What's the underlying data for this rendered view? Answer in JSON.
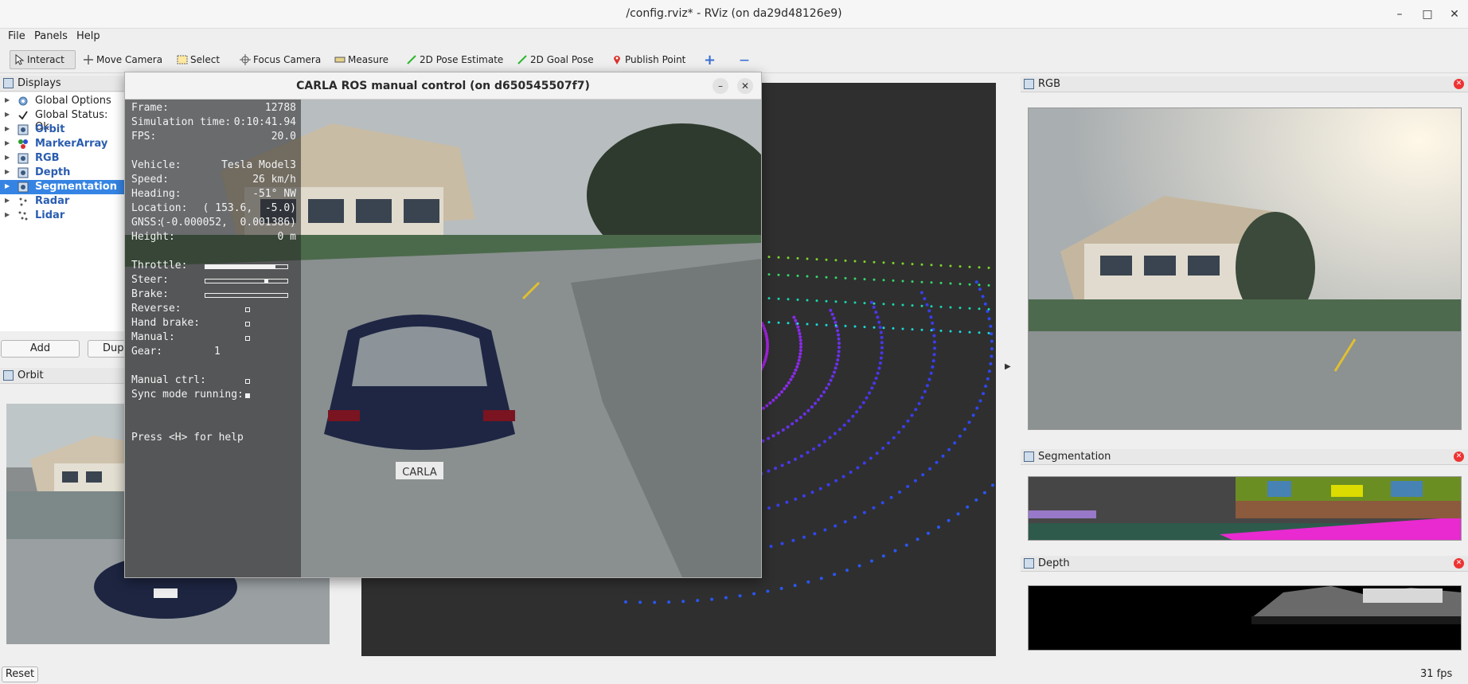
{
  "window": {
    "title": "/config.rviz* - RViz (on da29d48126e9)",
    "minimize": "–",
    "maximize": "□",
    "close": "✕"
  },
  "menu": [
    "File",
    "Panels",
    "Help"
  ],
  "toolbar": {
    "interact": "Interact",
    "move_camera": "Move Camera",
    "select": "Select",
    "focus_camera": "Focus Camera",
    "measure": "Measure",
    "pose_estimate": "2D Pose Estimate",
    "goal_pose": "2D Goal Pose",
    "publish_point": "Publish Point",
    "plus": "+",
    "minus": "—"
  },
  "displays": {
    "title": "Displays",
    "items": [
      {
        "label": "Global Options",
        "icon": "gear-icon"
      },
      {
        "label": "Global Status: Ok",
        "icon": "check-icon"
      },
      {
        "label": "Orbit",
        "icon": "camera-icon"
      },
      {
        "label": "MarkerArray",
        "icon": "markers-icon"
      },
      {
        "label": "RGB",
        "icon": "camera-icon"
      },
      {
        "label": "Depth",
        "icon": "camera-icon"
      },
      {
        "label": "Segmentation",
        "icon": "camera-icon"
      },
      {
        "label": "Radar",
        "icon": "radar-icon"
      },
      {
        "label": "Lidar",
        "icon": "lidar-icon"
      }
    ],
    "add_button": "Add",
    "duplicate_button": "Dupl"
  },
  "orbit_panel": {
    "title": "Orbit"
  },
  "carla": {
    "title": "CARLA ROS manual control (on d650545507f7)",
    "frame_label": "Frame:",
    "frame": "12788",
    "sim_time_label": "Simulation time:",
    "sim_time": "0:10:41.94",
    "fps_label": "FPS:",
    "fps": "20.0",
    "vehicle_label": "Vehicle:",
    "vehicle": "Tesla Model3",
    "speed_label": "Speed:",
    "speed": "26 km/h",
    "heading_label": "Heading:",
    "heading": "-51° NW",
    "location_label": "Location:",
    "location": "( 153.6,  -5.0)",
    "gnss_label": "GNSS:",
    "gnss": "(-0.000052,  0.001386)",
    "height_label": "Height:",
    "height": "0 m",
    "throttle_label": "Throttle:",
    "throttle": 0.85,
    "steer_label": "Steer:",
    "steer": 0.72,
    "brake_label": "Brake:",
    "brake": 0.0,
    "reverse_label": "Reverse:",
    "handbrake_label": "Hand brake:",
    "manual_label": "Manual:",
    "gear_label": "Gear:",
    "gear": "1",
    "manual_ctrl_label": "Manual ctrl:",
    "sync_label": "Sync mode running:",
    "help": "Press <H> for help",
    "plate": "CARLA"
  },
  "right_panels": {
    "rgb": "RGB",
    "segmentation": "Segmentation",
    "depth": "Depth"
  },
  "status": {
    "reset": "Reset",
    "fps": "31 fps"
  }
}
